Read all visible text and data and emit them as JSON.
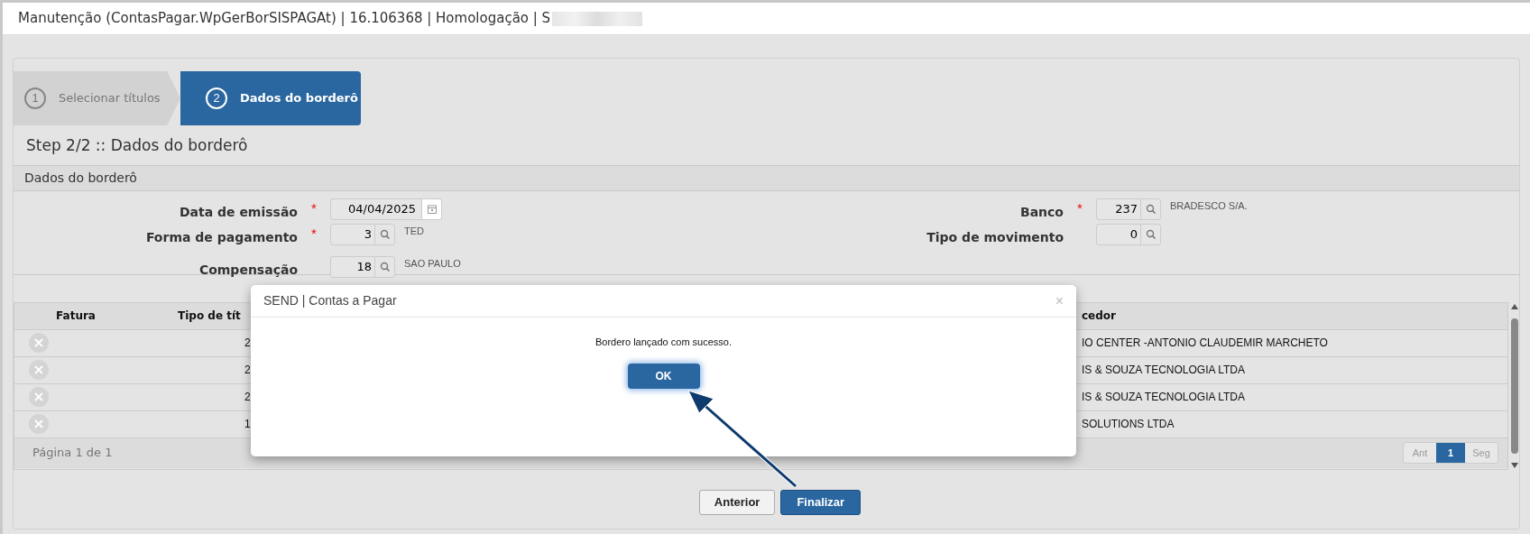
{
  "window": {
    "title": "Manutenção (ContasPagar.WpGerBorSISPAGAt) | 16.106368 | Homologação | S"
  },
  "steps": [
    {
      "number": "1",
      "label": "Selecionar títulos",
      "selected": false
    },
    {
      "number": "2",
      "label": "Dados do borderô",
      "selected": true
    }
  ],
  "step_title": "Step 2/2 :: Dados do borderô",
  "section": {
    "title": "Dados do borderô",
    "left_fields": [
      {
        "label": "Data de emissão",
        "required_mark": "*",
        "value": "04/04/2025",
        "kind": "date"
      },
      {
        "label": "Forma de pagamento",
        "required_mark": "*",
        "value": "3",
        "kind": "lookup",
        "description": "TED"
      },
      {
        "label": "Compensação",
        "value": "18",
        "kind": "lookup",
        "description": "SAO PAULO"
      }
    ],
    "right_fields": [
      {
        "label": "Banco",
        "required_mark": "*",
        "value": "237",
        "kind": "lookup",
        "description": "BRADESCO S/A."
      },
      {
        "label": "Tipo de movimento",
        "value": "0",
        "kind": "lookup"
      }
    ]
  },
  "table": {
    "columns": [
      "Fatura",
      "Tipo de tít",
      "cedor"
    ],
    "rows": [
      {
        "column_2": "2",
        "column_3": "IO CENTER -ANTONIO CLAUDEMIR MARCHETO"
      },
      {
        "column_2": "2",
        "column_3": "IS & SOUZA TECNOLOGIA LTDA"
      },
      {
        "column_2": "2",
        "column_3": "IS & SOUZA TECNOLOGIA LTDA"
      },
      {
        "column_2": "1",
        "column_3": "SOLUTIONS LTDA"
      }
    ],
    "page_info": "Página 1 de 1",
    "pager": [
      {
        "label": "Ant",
        "selected": false
      },
      {
        "label": "1",
        "selected": true
      },
      {
        "label": "Seg",
        "selected": false
      }
    ]
  },
  "buttons": [
    {
      "label": "Anterior",
      "kind": "secondary"
    },
    {
      "label": "Finalizar",
      "kind": "primary"
    }
  ],
  "dialog": {
    "title": "SEND | Contas a Pagar",
    "close": "×",
    "message": "Bordero lançado com sucesso.",
    "ok": "OK"
  }
}
